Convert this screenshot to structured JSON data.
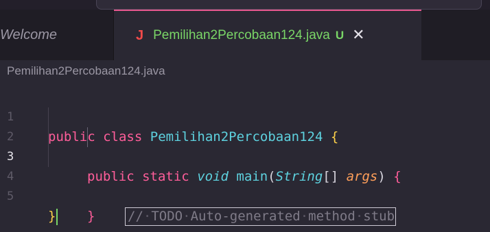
{
  "colors": {
    "background": "#2a2833",
    "tabbar": "#1f1d25",
    "active_tab_border": "#e8588f",
    "modified_file": "#7ad667",
    "keyword": "#ff5e9a",
    "type": "#5ed2df",
    "parameter": "#ff9f5a",
    "brace": "#ffd24a",
    "comment": "#7f7b88"
  },
  "tabs": [
    {
      "label": "Welcome",
      "active": false
    },
    {
      "label": "Pemilihan2Percobaan124.java",
      "icon": "J",
      "icon_name": "java-file-icon",
      "status": "U",
      "active": true,
      "close_icon": "close-icon"
    }
  ],
  "breadcrumb": "Pemilihan2Percobaan124.java",
  "editor": {
    "current_line": 3,
    "lines": [
      {
        "number": "1",
        "tokens": [
          "public",
          " ",
          "class",
          " ",
          "Pemilihan2Percobaan124",
          " ",
          "{"
        ]
      },
      {
        "number": "2",
        "tokens": [
          "public",
          " ",
          "static",
          " ",
          "void",
          " ",
          "main",
          "(",
          "String",
          "[]",
          " ",
          "args",
          ")",
          " ",
          "{"
        ]
      },
      {
        "number": "3",
        "tokens": [
          "//",
          "·",
          "TODO",
          "·",
          "Auto-generated",
          "·",
          "method",
          "·",
          "stub"
        ]
      },
      {
        "number": "4",
        "tokens": [
          "}"
        ]
      },
      {
        "number": "5",
        "tokens": [
          "}"
        ]
      }
    ]
  }
}
